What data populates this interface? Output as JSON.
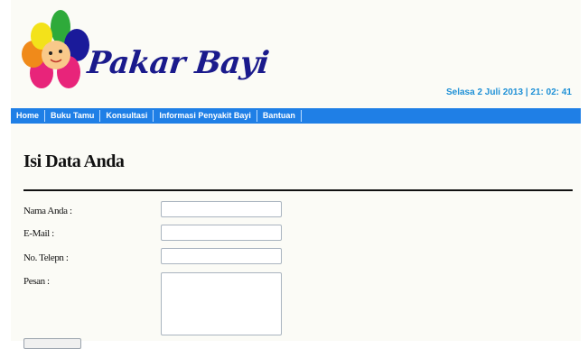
{
  "header": {
    "logo_text": "Pakar Bayi",
    "datetime": "Selasa 2 Juli 2013 | 21: 02: 41"
  },
  "nav": {
    "items": [
      "Home",
      "Buku Tamu",
      "Konsultasi",
      "Informasi Penyakit Bayi",
      "Bantuan"
    ]
  },
  "main": {
    "title": "Isi Data Anda",
    "form": {
      "name_label": "Nama Anda :",
      "name_value": "",
      "email_label": "E-Mail :",
      "email_value": "",
      "phone_label": "No. Telepn :",
      "phone_value": "",
      "message_label": "Pesan :",
      "message_value": ""
    }
  },
  "colors": {
    "nav_bar": "#1f7fe6",
    "datetime": "#1e90d6",
    "logo_text": "#1a1a8c",
    "page_bg": "#fbfbf6"
  }
}
